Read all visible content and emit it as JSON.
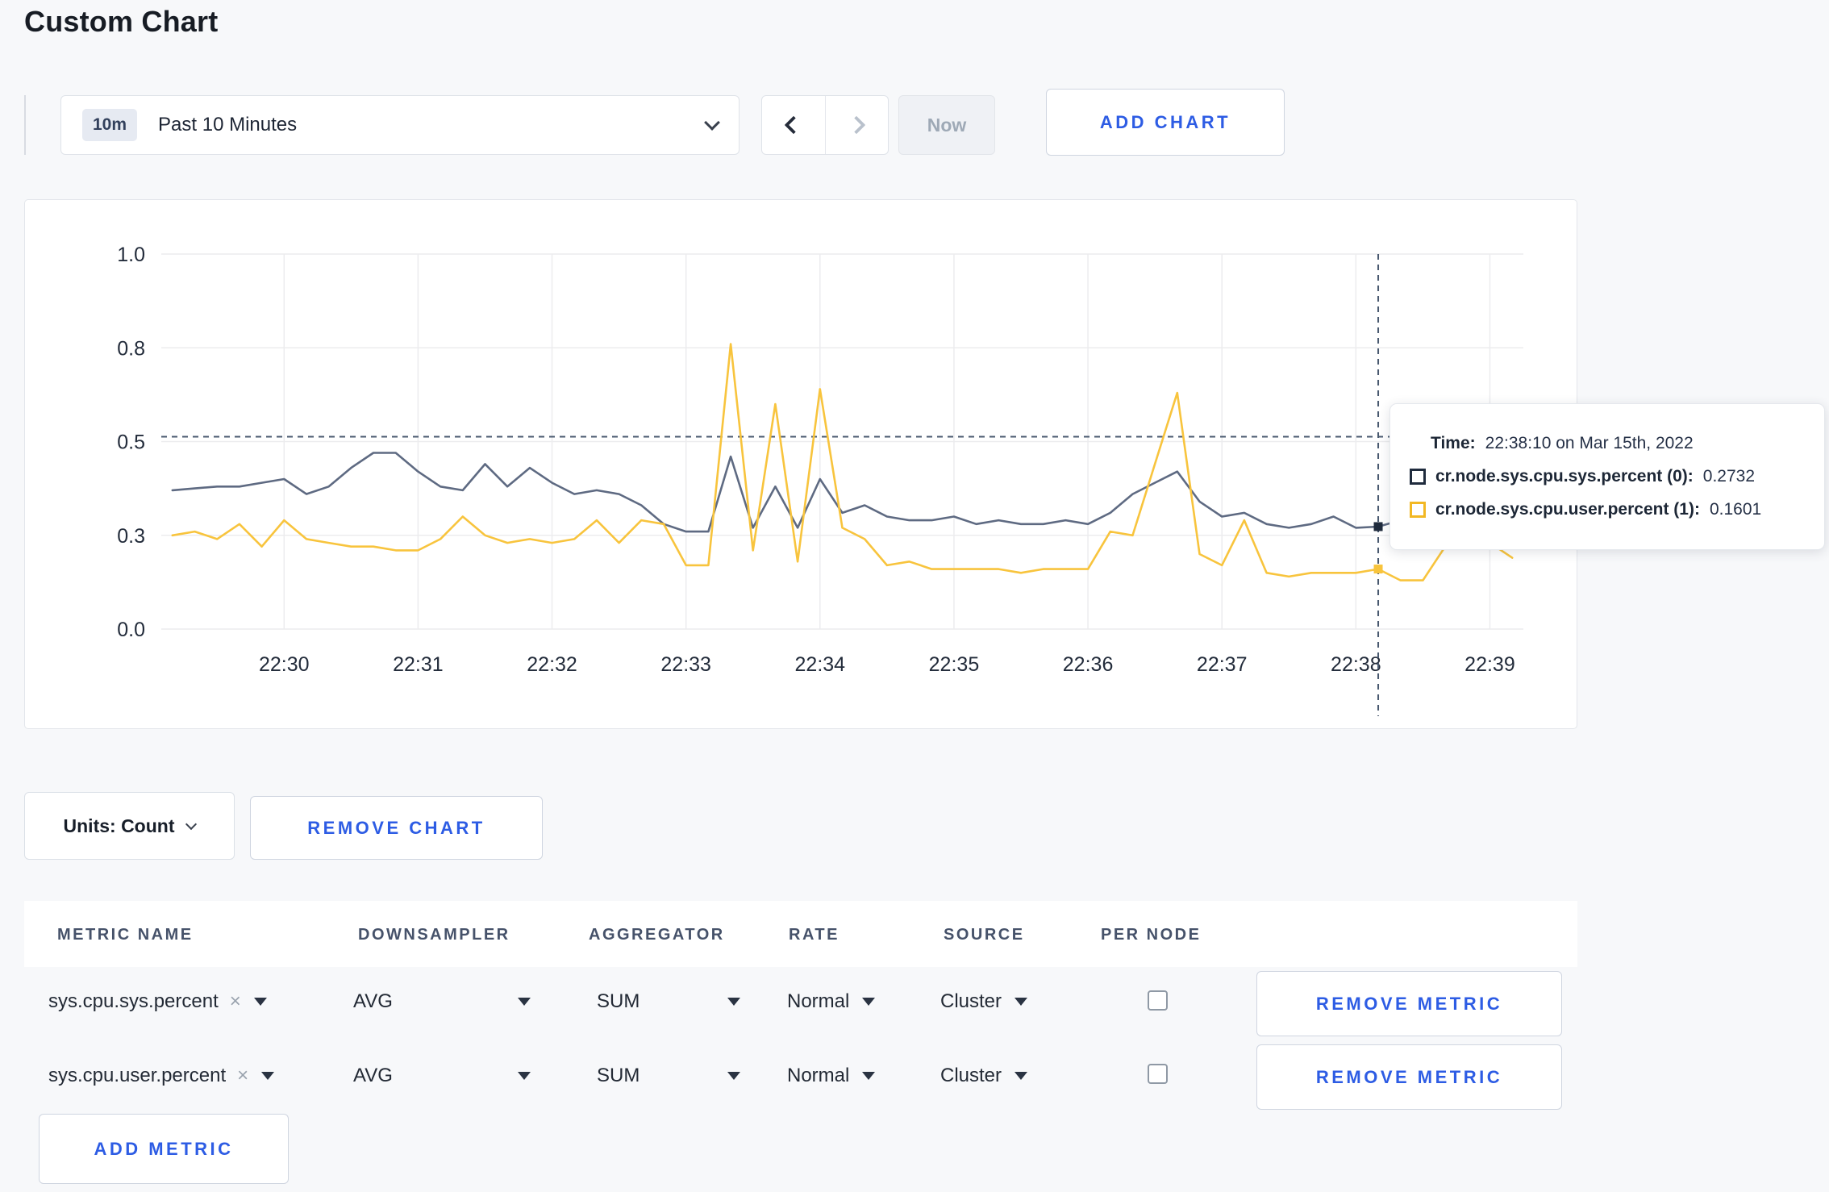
{
  "page": {
    "title": "Custom Chart"
  },
  "toolbar": {
    "range_badge": "10m",
    "range_label": "Past 10 Minutes",
    "prev_label": "previous time window",
    "next_label": "next time window",
    "now_label": "Now",
    "add_chart_label": "ADD CHART"
  },
  "chart_data": {
    "type": "line",
    "title": "",
    "xlabel": "",
    "ylabel": "",
    "ylim": [
      0,
      1
    ],
    "grid": true,
    "y_ticks": {
      "values": [
        0,
        0.25,
        0.5,
        0.75,
        1.0
      ],
      "labels": [
        "0.0",
        "0.3",
        "0.5",
        "0.8",
        "1.0"
      ]
    },
    "x_tick_labels": [
      "22:30",
      "22:31",
      "22:32",
      "22:33",
      "22:34",
      "22:35",
      "22:36",
      "22:37",
      "22:38",
      "22:39"
    ],
    "x_tick_seconds": [
      0,
      60,
      120,
      180,
      240,
      300,
      360,
      420,
      480,
      540
    ],
    "x_domain_seconds": [
      -55,
      555
    ],
    "x_start_sec": -50,
    "x_step_sec": 10,
    "point_count": 61,
    "series": [
      {
        "name": "cr.node.sys.cpu.sys.percent",
        "line_color": "#5e6a82",
        "swatch_color": "#1f2b3d",
        "values": [
          0.37,
          0.375,
          0.38,
          0.38,
          0.39,
          0.4,
          0.36,
          0.38,
          0.43,
          0.47,
          0.47,
          0.42,
          0.38,
          0.37,
          0.44,
          0.38,
          0.43,
          0.39,
          0.36,
          0.37,
          0.36,
          0.33,
          0.28,
          0.26,
          0.26,
          0.46,
          0.27,
          0.38,
          0.27,
          0.4,
          0.31,
          0.33,
          0.3,
          0.29,
          0.29,
          0.3,
          0.28,
          0.29,
          0.28,
          0.28,
          0.29,
          0.28,
          0.31,
          0.36,
          0.39,
          0.42,
          0.34,
          0.3,
          0.31,
          0.28,
          0.27,
          0.28,
          0.3,
          0.27,
          0.2732,
          0.29,
          0.3,
          0.3,
          0.31,
          0.3,
          0.3
        ]
      },
      {
        "name": "cr.node.sys.cpu.user.percent",
        "line_color": "#f8c43d",
        "swatch_color": "#f2b824",
        "values": [
          0.25,
          0.26,
          0.24,
          0.28,
          0.22,
          0.29,
          0.24,
          0.23,
          0.22,
          0.22,
          0.21,
          0.21,
          0.24,
          0.3,
          0.25,
          0.23,
          0.24,
          0.23,
          0.24,
          0.29,
          0.23,
          0.29,
          0.28,
          0.17,
          0.17,
          0.76,
          0.21,
          0.6,
          0.18,
          0.64,
          0.27,
          0.24,
          0.17,
          0.18,
          0.16,
          0.16,
          0.16,
          0.16,
          0.15,
          0.16,
          0.16,
          0.16,
          0.26,
          0.25,
          0.44,
          0.63,
          0.2,
          0.17,
          0.29,
          0.15,
          0.14,
          0.15,
          0.15,
          0.15,
          0.1601,
          0.13,
          0.13,
          0.22,
          0.24,
          0.23,
          0.19
        ]
      }
    ],
    "crosshair": {
      "x_sec": 490,
      "y_value": 0.513,
      "color": "#49596f"
    },
    "legend_position": "tooltip"
  },
  "tooltip": {
    "time_label": "Time:",
    "time_value": "22:38:10 on Mar 15th, 2022",
    "rows": [
      {
        "label": "cr.node.sys.cpu.sys.percent (0):",
        "value": "0.2732"
      },
      {
        "label": "cr.node.sys.cpu.user.percent (1):",
        "value": "0.1601"
      }
    ]
  },
  "chart_footer": {
    "units_label": "Units: Count",
    "remove_chart_label": "REMOVE CHART"
  },
  "metrics_table": {
    "headers": [
      "METRIC NAME",
      "DOWNSAMPLER",
      "AGGREGATOR",
      "RATE",
      "SOURCE",
      "PER NODE"
    ],
    "rows": [
      {
        "metric": "sys.cpu.sys.percent",
        "clear": "×",
        "downsampler": "AVG",
        "aggregator": "SUM",
        "rate": "Normal",
        "source": "Cluster",
        "per_node_checked": false,
        "remove_label": "REMOVE METRIC"
      },
      {
        "metric": "sys.cpu.user.percent",
        "clear": "×",
        "downsampler": "AVG",
        "aggregator": "SUM",
        "rate": "Normal",
        "source": "Cluster",
        "per_node_checked": false,
        "remove_label": "REMOVE METRIC"
      }
    ],
    "add_metric_label": "ADD METRIC"
  },
  "colors": {
    "accent_blue": "#2d5ce4",
    "grid_line": "#ececee",
    "page_bg": "#f7f8fa"
  }
}
